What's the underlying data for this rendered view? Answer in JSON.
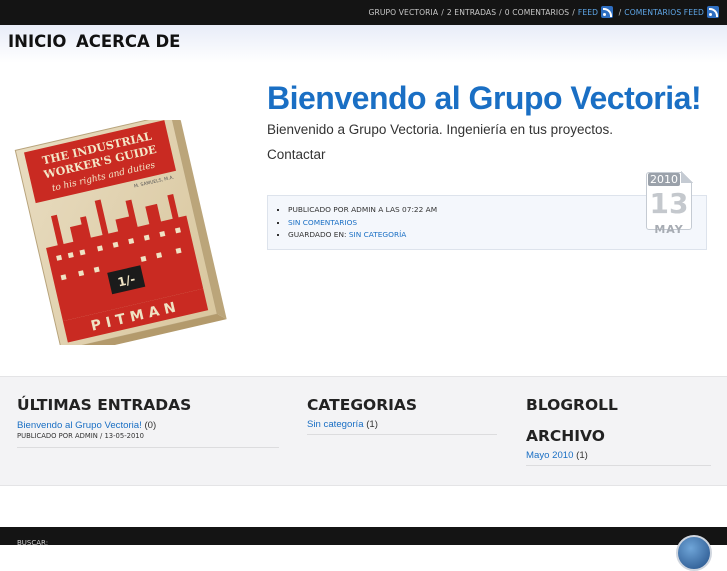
{
  "topbar": {
    "site": "GRUPO VECTORIA",
    "entries": "2 ENTRADAS",
    "comments": "0 COMENTARIOS",
    "feed": "FEED",
    "comments_feed": "COMENTARIOS FEED"
  },
  "nav": {
    "items": [
      "INICIO",
      "ACERCA DE"
    ]
  },
  "post": {
    "title": "Bienvendo al Grupo Vectoria!",
    "body": "Bienvenido a Grupo Vectoria. Ingeniería en tus proyectos.",
    "contact": "Contactar",
    "meta_published": "PUBLICADO POR ADMIN A LAS 07:22 AM",
    "meta_comments": "SIN COMENTARIOS",
    "meta_saved_label": "GUARDADO EN:",
    "meta_category": "SIN CATEGORÍA",
    "date": {
      "year": "2010",
      "day": "13",
      "month": "MAY"
    }
  },
  "book": {
    "title_line1": "THE INDUSTRIAL",
    "title_line2": "WORKER'S GUIDE",
    "subtitle": "to his rights and duties",
    "author": "M. SAMUELS, M.A.",
    "price": "1/-",
    "publisher": "PITMAN"
  },
  "widgets": {
    "recent": {
      "title": "ÚLTIMAS ENTRADAS",
      "link": "Bienvendo al Grupo Vectoria!",
      "count": "(0)",
      "meta": "PUBLICADO POR ADMIN / 13-05-2010"
    },
    "categories": {
      "title": "CATEGORIAS",
      "link": "Sin categoría",
      "count": "(1)"
    },
    "blogroll": {
      "title": "BLOGROLL"
    },
    "archive": {
      "title": "ARCHIVO",
      "link": "Mayo 2010",
      "count": "(1)"
    }
  },
  "footer": {
    "search_label": "BUSCAR:"
  },
  "colors": {
    "accent": "#1a6fc4",
    "topbar": "#141414",
    "link": "#5fa7e8"
  },
  "icons": [
    "rss-icon",
    "globe-icon"
  ]
}
